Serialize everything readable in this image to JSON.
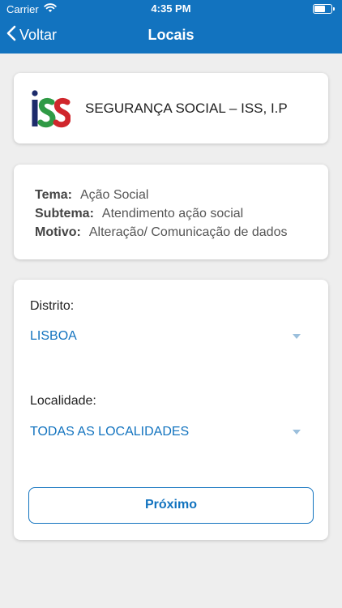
{
  "status_bar": {
    "carrier": "Carrier",
    "time": "4:35 PM",
    "battery_level": 0.7
  },
  "nav": {
    "back_label": "Voltar",
    "title": "Locais"
  },
  "organization": {
    "logo_text": "ISS",
    "name": "SEGURANÇA SOCIAL – ISS, I.P"
  },
  "info": {
    "rows": [
      {
        "key": "Tema:",
        "value": "Ação Social"
      },
      {
        "key": "Subtema:",
        "value": "Atendimento ação social"
      },
      {
        "key": "Motivo:",
        "value": "Alteração/ Comunicação de dados"
      }
    ]
  },
  "form": {
    "district_label": "Distrito:",
    "district_value": "LISBOA",
    "locality_label": "Localidade:",
    "locality_value": "TODAS AS LOCALIDADES",
    "next_button": "Próximo"
  },
  "colors": {
    "brand": "#1273bf",
    "background": "#eeeeee",
    "logo_green": "#2f9a45",
    "logo_red": "#d0262c",
    "logo_navy": "#1d2b6b"
  }
}
